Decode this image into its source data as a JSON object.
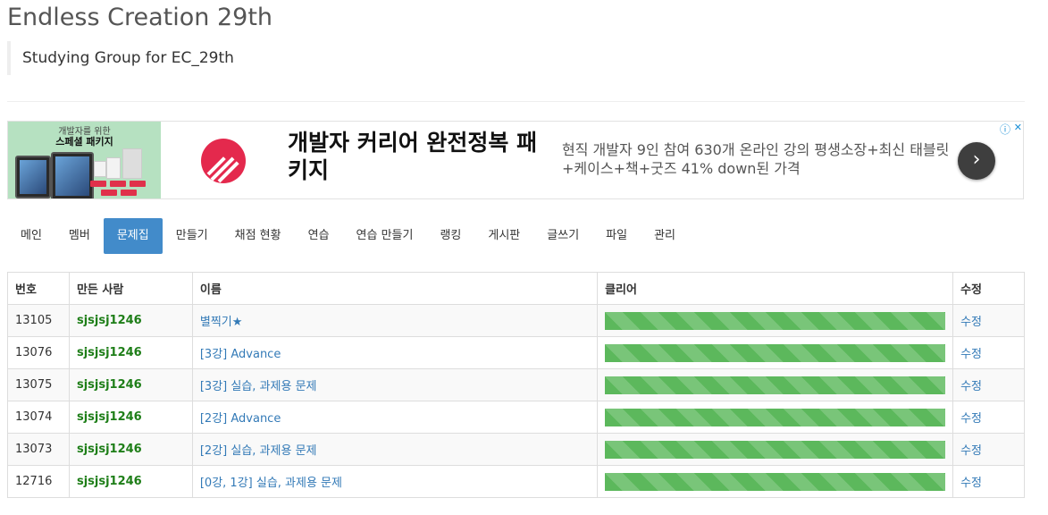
{
  "header": {
    "title": "Endless Creation 29th",
    "subtitle": "Studying Group for EC_29th"
  },
  "ad": {
    "thumb_line1": "개발자를 위한",
    "thumb_line2": "스페셜 패키지",
    "headline": "개발자 커리어 완전정복 패키지",
    "description": "현직 개발자 9인 참여 630개 온라인 강의 평생소장+최신 태블릿+케이스+책+굿즈 41% down된 가격",
    "info_icon": "info-icon",
    "close_icon": "close-icon",
    "arrow_icon": "chevron-right-icon",
    "logo_color": "#e4294d"
  },
  "nav": {
    "items": [
      {
        "label": "메인"
      },
      {
        "label": "멤버"
      },
      {
        "label": "문제집"
      },
      {
        "label": "만들기"
      },
      {
        "label": "채점 현황"
      },
      {
        "label": "연습"
      },
      {
        "label": "연습 만들기"
      },
      {
        "label": "랭킹"
      },
      {
        "label": "게시판"
      },
      {
        "label": "글쓰기"
      },
      {
        "label": "파일"
      },
      {
        "label": "관리"
      }
    ],
    "active": "문제집",
    "accent": "#428bca"
  },
  "table": {
    "headers": {
      "num": "번호",
      "author": "만든 사람",
      "name": "이름",
      "clear": "클리어",
      "edit": "수정"
    },
    "progress_color": "#5cb85c",
    "rows": [
      {
        "num": "13105",
        "author": "sjsjsj1246",
        "name": "별찍기★",
        "clear": 1.0,
        "edit": "수정"
      },
      {
        "num": "13076",
        "author": "sjsjsj1246",
        "name": "[3강] Advance",
        "clear": 1.0,
        "edit": "수정"
      },
      {
        "num": "13075",
        "author": "sjsjsj1246",
        "name": "[3강] 실습, 과제용 문제",
        "clear": 1.0,
        "edit": "수정"
      },
      {
        "num": "13074",
        "author": "sjsjsj1246",
        "name": "[2강] Advance",
        "clear": 1.0,
        "edit": "수정"
      },
      {
        "num": "13073",
        "author": "sjsjsj1246",
        "name": "[2강] 실습, 과제용 문제",
        "clear": 1.0,
        "edit": "수정"
      },
      {
        "num": "12716",
        "author": "sjsjsj1246",
        "name": "[0강, 1강] 실습, 과제용 문제",
        "clear": 1.0,
        "edit": "수정"
      }
    ]
  }
}
